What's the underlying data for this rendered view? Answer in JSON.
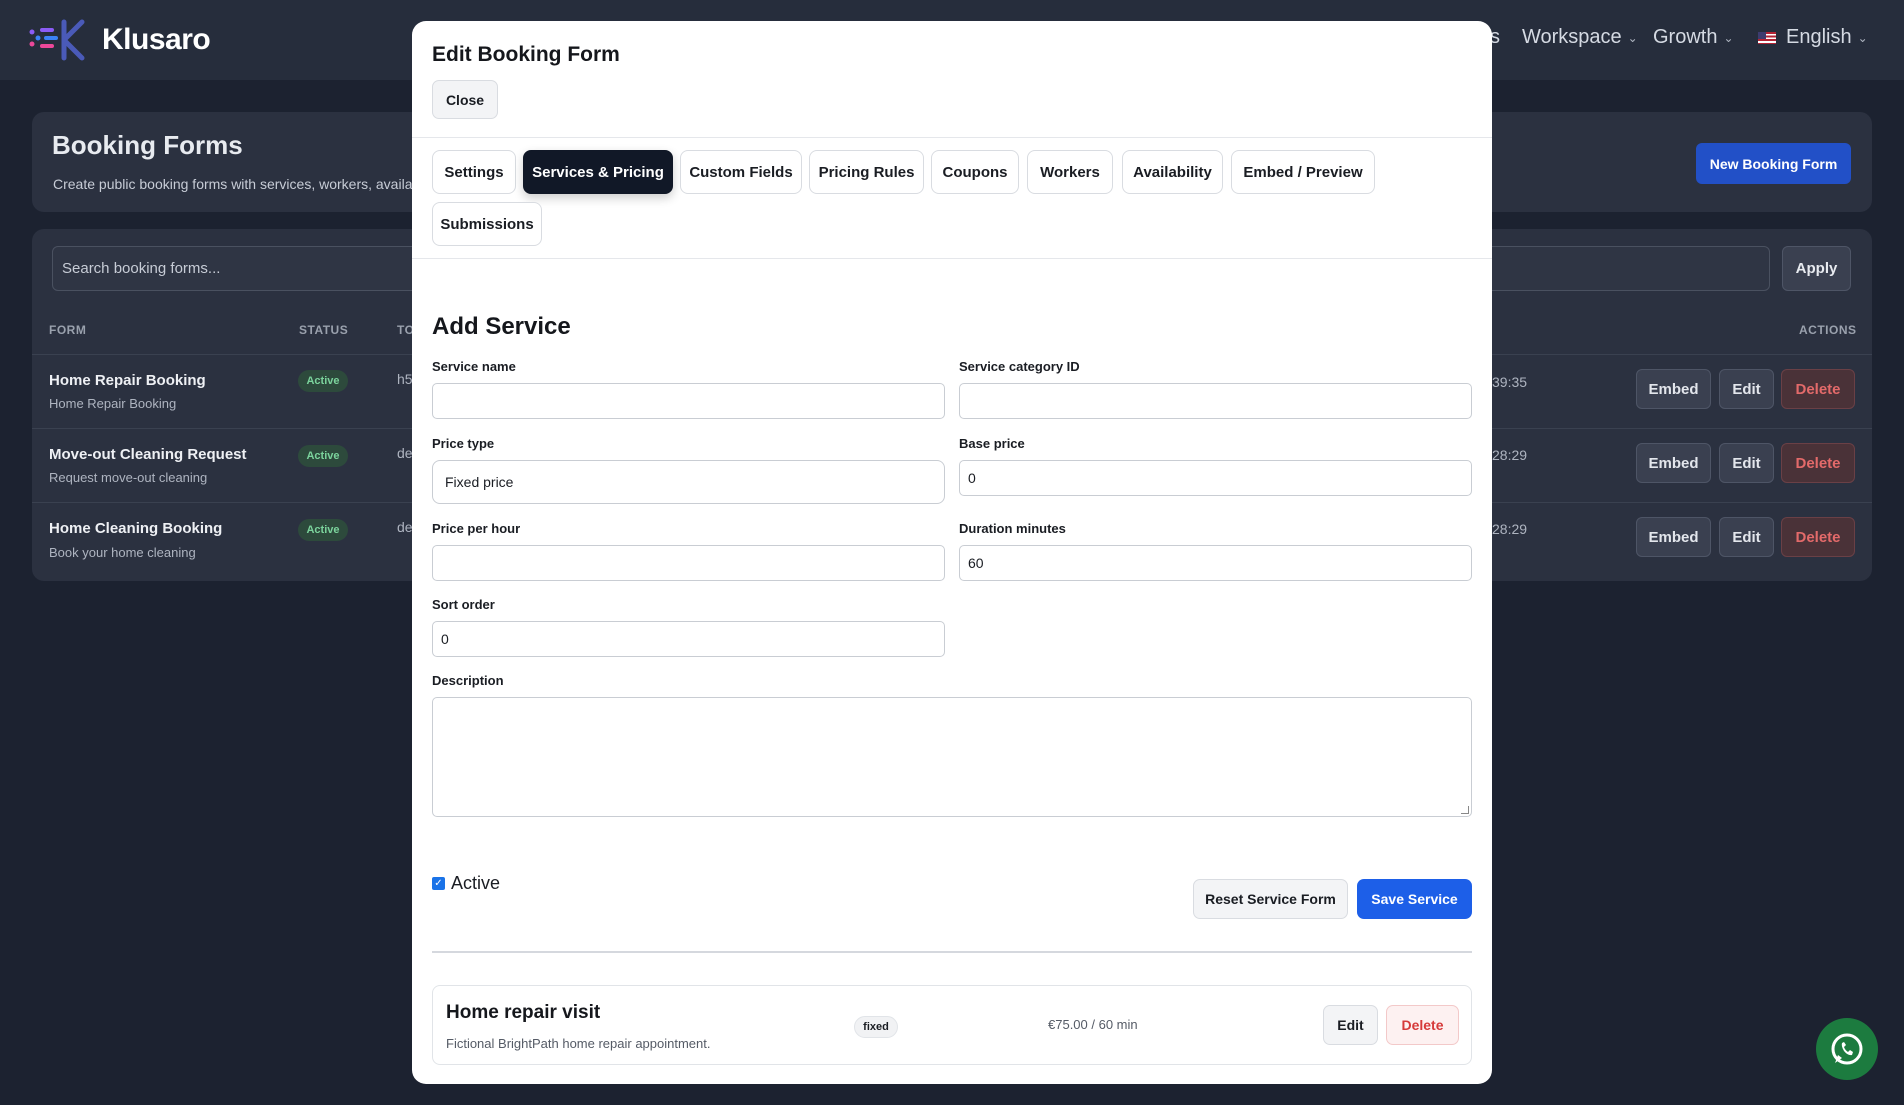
{
  "app": {
    "brand": "Klusaro",
    "nav": [
      {
        "label": "s"
      },
      {
        "label": "Workspace"
      },
      {
        "label": "Growth"
      },
      {
        "label": "English"
      }
    ]
  },
  "page": {
    "title": "Booking Forms",
    "subtitle": "Create public booking forms with services, workers, availabili",
    "new_button": "New Booking Form",
    "search_placeholder": "Search booking forms...",
    "apply_button": "Apply",
    "columns": {
      "form": "FORM",
      "status": "STATUS",
      "third": "TO",
      "actions": "ACTIONS"
    },
    "rows": [
      {
        "name": "Home Repair Booking",
        "desc": "Home Repair Booking",
        "status": "Active",
        "slug": "h5",
        "time": "39:35"
      },
      {
        "name": "Move-out Cleaning Request",
        "desc": "Request move-out cleaning",
        "status": "Active",
        "slug": "de",
        "time": "28:29"
      },
      {
        "name": "Home Cleaning Booking",
        "desc": "Book your home cleaning",
        "status": "Active",
        "slug": "de",
        "time": "28:29"
      }
    ],
    "row_actions": {
      "embed": "Embed",
      "edit": "Edit",
      "delete": "Delete"
    }
  },
  "modal": {
    "title": "Edit Booking Form",
    "close": "Close",
    "tabs": [
      {
        "label": "Settings"
      },
      {
        "label": "Services & Pricing",
        "active": true
      },
      {
        "label": "Custom Fields"
      },
      {
        "label": "Pricing Rules"
      },
      {
        "label": "Coupons"
      },
      {
        "label": "Workers"
      },
      {
        "label": "Availability"
      },
      {
        "label": "Embed / Preview"
      },
      {
        "label": "Submissions"
      }
    ],
    "section_title": "Add Service",
    "fields": {
      "service_name": {
        "label": "Service name",
        "value": ""
      },
      "category_id": {
        "label": "Service category ID",
        "value": ""
      },
      "price_type": {
        "label": "Price type",
        "value": "Fixed price"
      },
      "base_price": {
        "label": "Base price",
        "value": "0"
      },
      "price_per_hour": {
        "label": "Price per hour",
        "value": ""
      },
      "duration": {
        "label": "Duration minutes",
        "value": "60"
      },
      "sort_order": {
        "label": "Sort order",
        "value": "0"
      },
      "description": {
        "label": "Description",
        "value": ""
      }
    },
    "active_label": "Active",
    "active_checked": true,
    "reset_button": "Reset Service Form",
    "save_button": "Save Service",
    "services": [
      {
        "name": "Home repair visit",
        "desc": "Fictional BrightPath home repair appointment.",
        "type": "fixed",
        "price": "€75.00 / 60 min",
        "edit": "Edit",
        "delete": "Delete"
      }
    ]
  },
  "colors": {
    "accent": "#1d5fe8",
    "active_tab": "#111827",
    "danger": "#d63a3a"
  }
}
